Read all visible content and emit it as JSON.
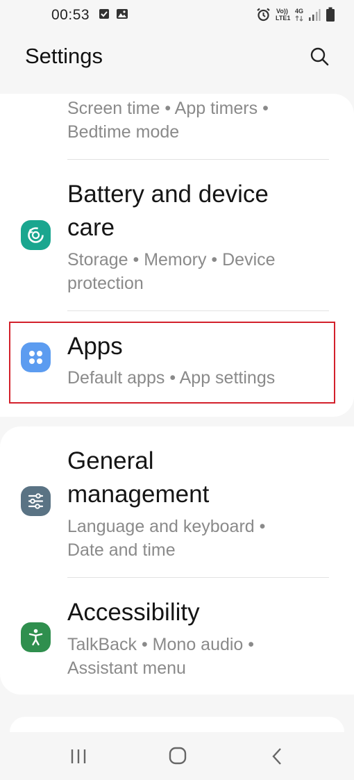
{
  "status_bar": {
    "time": "00:53",
    "volte_top": "Vo))",
    "volte_bottom": "LTE1",
    "network": "4G"
  },
  "header": {
    "title": "Settings"
  },
  "items": {
    "digital_wellbeing": {
      "subtitle_line1": "Screen time  •  App timers  •",
      "subtitle_line2": "Bedtime mode"
    },
    "battery": {
      "title_line1": "Battery and device",
      "title_line2": "care",
      "subtitle_line1": "Storage  •  Memory  •  Device",
      "subtitle_line2": "protection"
    },
    "apps": {
      "title": "Apps",
      "subtitle": "Default apps  •  App settings"
    },
    "general": {
      "title_line1": "General",
      "title_line2": "management",
      "subtitle_line1": "Language and keyboard  •",
      "subtitle_line2": "Date and time"
    },
    "accessibility": {
      "title": "Accessibility",
      "subtitle_line1": "TalkBack  •  Mono audio  •",
      "subtitle_line2": "Assistant menu"
    }
  },
  "colors": {
    "battery_icon": "#1aa68f",
    "apps_icon": "#5c9cf0",
    "general_icon": "#5a7384",
    "accessibility_icon": "#2f8f4e",
    "highlight": "#d3202b"
  },
  "icons": {
    "search": "search-icon",
    "battery": "device-care-icon",
    "apps": "apps-grid-icon",
    "general": "sliders-icon",
    "accessibility": "accessibility-person-icon"
  }
}
